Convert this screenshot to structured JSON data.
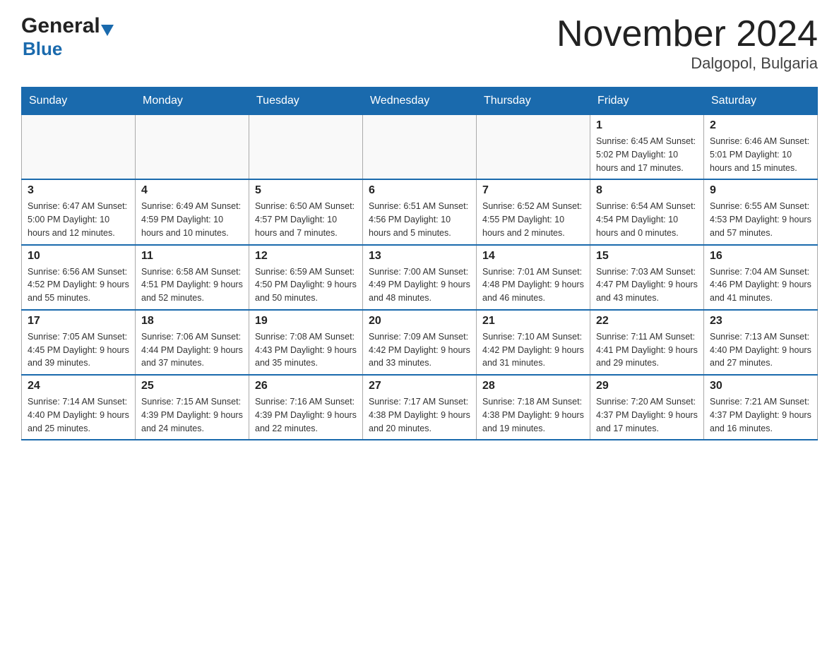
{
  "header": {
    "logo_general": "General",
    "logo_blue": "Blue",
    "title": "November 2024",
    "subtitle": "Dalgopol, Bulgaria"
  },
  "days_of_week": [
    "Sunday",
    "Monday",
    "Tuesday",
    "Wednesday",
    "Thursday",
    "Friday",
    "Saturday"
  ],
  "weeks": [
    [
      {
        "day": "",
        "info": ""
      },
      {
        "day": "",
        "info": ""
      },
      {
        "day": "",
        "info": ""
      },
      {
        "day": "",
        "info": ""
      },
      {
        "day": "",
        "info": ""
      },
      {
        "day": "1",
        "info": "Sunrise: 6:45 AM\nSunset: 5:02 PM\nDaylight: 10 hours\nand 17 minutes."
      },
      {
        "day": "2",
        "info": "Sunrise: 6:46 AM\nSunset: 5:01 PM\nDaylight: 10 hours\nand 15 minutes."
      }
    ],
    [
      {
        "day": "3",
        "info": "Sunrise: 6:47 AM\nSunset: 5:00 PM\nDaylight: 10 hours\nand 12 minutes."
      },
      {
        "day": "4",
        "info": "Sunrise: 6:49 AM\nSunset: 4:59 PM\nDaylight: 10 hours\nand 10 minutes."
      },
      {
        "day": "5",
        "info": "Sunrise: 6:50 AM\nSunset: 4:57 PM\nDaylight: 10 hours\nand 7 minutes."
      },
      {
        "day": "6",
        "info": "Sunrise: 6:51 AM\nSunset: 4:56 PM\nDaylight: 10 hours\nand 5 minutes."
      },
      {
        "day": "7",
        "info": "Sunrise: 6:52 AM\nSunset: 4:55 PM\nDaylight: 10 hours\nand 2 minutes."
      },
      {
        "day": "8",
        "info": "Sunrise: 6:54 AM\nSunset: 4:54 PM\nDaylight: 10 hours\nand 0 minutes."
      },
      {
        "day": "9",
        "info": "Sunrise: 6:55 AM\nSunset: 4:53 PM\nDaylight: 9 hours\nand 57 minutes."
      }
    ],
    [
      {
        "day": "10",
        "info": "Sunrise: 6:56 AM\nSunset: 4:52 PM\nDaylight: 9 hours\nand 55 minutes."
      },
      {
        "day": "11",
        "info": "Sunrise: 6:58 AM\nSunset: 4:51 PM\nDaylight: 9 hours\nand 52 minutes."
      },
      {
        "day": "12",
        "info": "Sunrise: 6:59 AM\nSunset: 4:50 PM\nDaylight: 9 hours\nand 50 minutes."
      },
      {
        "day": "13",
        "info": "Sunrise: 7:00 AM\nSunset: 4:49 PM\nDaylight: 9 hours\nand 48 minutes."
      },
      {
        "day": "14",
        "info": "Sunrise: 7:01 AM\nSunset: 4:48 PM\nDaylight: 9 hours\nand 46 minutes."
      },
      {
        "day": "15",
        "info": "Sunrise: 7:03 AM\nSunset: 4:47 PM\nDaylight: 9 hours\nand 43 minutes."
      },
      {
        "day": "16",
        "info": "Sunrise: 7:04 AM\nSunset: 4:46 PM\nDaylight: 9 hours\nand 41 minutes."
      }
    ],
    [
      {
        "day": "17",
        "info": "Sunrise: 7:05 AM\nSunset: 4:45 PM\nDaylight: 9 hours\nand 39 minutes."
      },
      {
        "day": "18",
        "info": "Sunrise: 7:06 AM\nSunset: 4:44 PM\nDaylight: 9 hours\nand 37 minutes."
      },
      {
        "day": "19",
        "info": "Sunrise: 7:08 AM\nSunset: 4:43 PM\nDaylight: 9 hours\nand 35 minutes."
      },
      {
        "day": "20",
        "info": "Sunrise: 7:09 AM\nSunset: 4:42 PM\nDaylight: 9 hours\nand 33 minutes."
      },
      {
        "day": "21",
        "info": "Sunrise: 7:10 AM\nSunset: 4:42 PM\nDaylight: 9 hours\nand 31 minutes."
      },
      {
        "day": "22",
        "info": "Sunrise: 7:11 AM\nSunset: 4:41 PM\nDaylight: 9 hours\nand 29 minutes."
      },
      {
        "day": "23",
        "info": "Sunrise: 7:13 AM\nSunset: 4:40 PM\nDaylight: 9 hours\nand 27 minutes."
      }
    ],
    [
      {
        "day": "24",
        "info": "Sunrise: 7:14 AM\nSunset: 4:40 PM\nDaylight: 9 hours\nand 25 minutes."
      },
      {
        "day": "25",
        "info": "Sunrise: 7:15 AM\nSunset: 4:39 PM\nDaylight: 9 hours\nand 24 minutes."
      },
      {
        "day": "26",
        "info": "Sunrise: 7:16 AM\nSunset: 4:39 PM\nDaylight: 9 hours\nand 22 minutes."
      },
      {
        "day": "27",
        "info": "Sunrise: 7:17 AM\nSunset: 4:38 PM\nDaylight: 9 hours\nand 20 minutes."
      },
      {
        "day": "28",
        "info": "Sunrise: 7:18 AM\nSunset: 4:38 PM\nDaylight: 9 hours\nand 19 minutes."
      },
      {
        "day": "29",
        "info": "Sunrise: 7:20 AM\nSunset: 4:37 PM\nDaylight: 9 hours\nand 17 minutes."
      },
      {
        "day": "30",
        "info": "Sunrise: 7:21 AM\nSunset: 4:37 PM\nDaylight: 9 hours\nand 16 minutes."
      }
    ]
  ]
}
